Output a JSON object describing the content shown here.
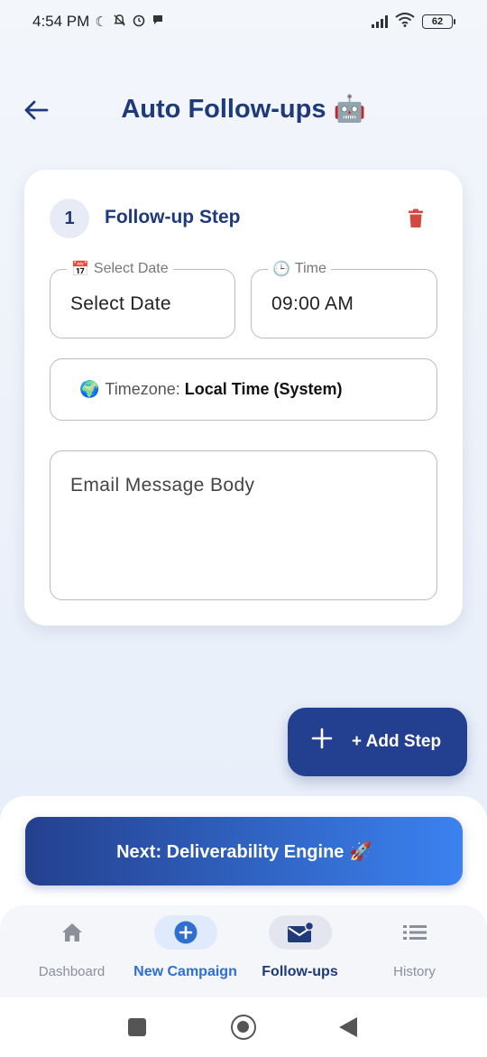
{
  "status_bar": {
    "time": "4:54 PM",
    "battery": "62"
  },
  "header": {
    "title": "Auto Follow-ups 🤖"
  },
  "step": {
    "number": "1",
    "title": "Follow-up Step",
    "date": {
      "legend_icon": "📅",
      "legend": "Select Date",
      "value": "Select Date"
    },
    "time": {
      "legend_icon": "🕒",
      "legend": "Time",
      "value": "09:00 AM"
    },
    "timezone": {
      "icon": "🌍",
      "label": "Timezone:",
      "value": "Local Time (System)"
    },
    "body": {
      "placeholder": "Email Message Body"
    }
  },
  "add_step": {
    "label": "+ Add Step"
  },
  "next_button": {
    "label": "Next: Deliverability Engine 🚀"
  },
  "nav": {
    "items": [
      {
        "label": "Dashboard"
      },
      {
        "label": "New Campaign"
      },
      {
        "label": "Follow-ups"
      },
      {
        "label": "History"
      }
    ]
  },
  "colors": {
    "primary": "#1e3a7b",
    "accent": "#2f6fd1",
    "danger": "#d14a3f",
    "gradient_end": "#3b82f0"
  }
}
